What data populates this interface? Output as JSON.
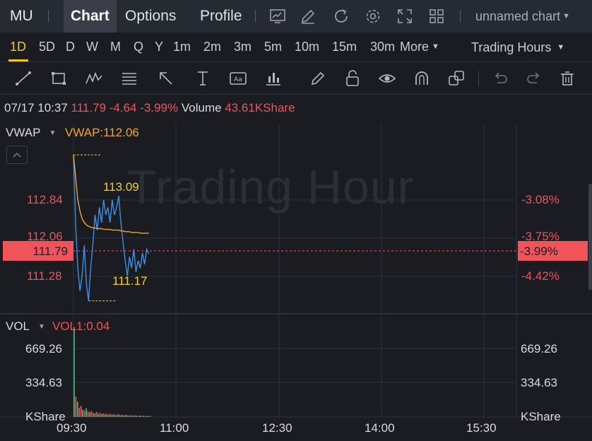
{
  "header": {
    "symbol": "MU",
    "tabs": [
      {
        "label": "Chart",
        "active": true
      },
      {
        "label": "Options",
        "active": false
      },
      {
        "label": "Profile",
        "active": false
      }
    ],
    "icons": [
      "chart-screen-icon",
      "draw-pen-icon",
      "refresh-icon",
      "settings-gear-icon",
      "fullscreen-icon",
      "layout-grid-icon"
    ],
    "chart_name": "unnamed chart"
  },
  "timeframes": {
    "items": [
      "1D",
      "5D",
      "D",
      "W",
      "M",
      "Q",
      "Y",
      "1m",
      "2m",
      "3m",
      "5m",
      "10m",
      "15m",
      "30m"
    ],
    "active": "1D",
    "more_label": "More",
    "hours_label": "Trading Hours"
  },
  "drawing_tools": [
    "trend-line-icon",
    "rectangle-icon",
    "wave-pattern-icon",
    "fibonacci-icon",
    "arrow-icon",
    "measure-icon",
    "text-note-icon",
    "bars-pattern-icon",
    "pencil-icon",
    "lock-icon",
    "eye-icon",
    "magnet-icon",
    "layers-icon",
    "undo-icon",
    "redo-icon",
    "trash-icon"
  ],
  "info": {
    "datetime": "07/17 10:37",
    "price": "111.79",
    "change": "-4.64",
    "change_pct": "-3.99%",
    "volume_label": "Volume",
    "volume_value": "43.61KShare"
  },
  "main_pane": {
    "indicator": "VWAP",
    "indicator_value": "VWAP:112.06",
    "watermark": "Trading Hour",
    "price_ticks": [
      "112.84",
      "112.06",
      "111.28"
    ],
    "pct_ticks": [
      "-3.08%",
      "-3.75%",
      "-4.42%"
    ],
    "current_price": "111.79",
    "current_pct": "-3.99%",
    "high_marker": "113.09",
    "low_marker": "111.17"
  },
  "volume_pane": {
    "indicator": "VOL",
    "indicator_value": "VOL1:0.04",
    "ticks": [
      "669.26",
      "334.63",
      "KShare"
    ]
  },
  "x_axis": [
    "09:30",
    "11:00",
    "12:30",
    "14:00",
    "15:30"
  ],
  "chart_data": [
    {
      "type": "line",
      "title": "",
      "series": [
        {
          "name": "Price",
          "values": [
            113.09,
            112.2,
            111.6,
            111.3,
            111.5,
            111.9,
            111.4,
            111.17,
            111.6,
            111.9,
            112.3,
            112.1,
            112.4,
            112.2,
            112.5,
            112.3,
            112.4,
            112.2,
            112.5,
            112.3,
            112.4,
            112.55,
            112.2,
            111.95,
            111.7,
            111.5,
            111.75,
            111.6,
            111.85,
            111.55,
            111.7,
            111.6,
            111.8,
            111.65,
            111.85,
            111.79
          ]
        },
        {
          "name": "VWAP",
          "values": [
            113.09,
            112.8,
            112.5,
            112.35,
            112.25,
            112.2,
            112.17,
            112.15,
            112.14,
            112.13,
            112.13,
            112.12,
            112.12,
            112.12,
            112.11,
            112.11,
            112.11,
            112.11,
            112.1,
            112.1,
            112.1,
            112.1,
            112.09,
            112.09,
            112.08,
            112.08,
            112.08,
            112.07,
            112.07,
            112.07,
            112.07,
            112.06,
            112.06,
            112.06,
            112.06,
            112.06
          ]
        }
      ],
      "ylim": [
        111.0,
        113.5
      ],
      "colors": {
        "price": "#3d8fe6",
        "vwap": "#f2a32a"
      }
    },
    {
      "type": "bar",
      "title": "",
      "values": [
        669,
        200,
        150,
        90,
        110,
        70,
        60,
        85,
        55,
        45,
        60,
        40,
        35,
        50,
        30,
        42,
        28,
        36,
        25,
        33,
        22,
        30,
        20,
        28,
        18,
        26,
        24,
        17,
        22,
        15,
        20,
        16,
        14,
        18,
        12,
        16,
        13,
        11,
        14,
        10,
        12,
        9,
        11,
        8,
        10
      ],
      "colors": [
        "green",
        "red",
        "green",
        "red",
        "red",
        "green",
        "red",
        "green",
        "red",
        "green",
        "red",
        "red",
        "green",
        "red",
        "green",
        "red",
        "green",
        "red",
        "green",
        "red",
        "green",
        "red",
        "green",
        "red",
        "green",
        "red",
        "green",
        "red",
        "green",
        "red",
        "green",
        "red",
        "green",
        "red",
        "green",
        "red",
        "green",
        "red",
        "green",
        "red",
        "green",
        "red",
        "green",
        "red",
        "green"
      ],
      "ylim": [
        0,
        700
      ],
      "palette": {
        "green": "#3fb57a",
        "red": "#e8504f"
      }
    }
  ]
}
